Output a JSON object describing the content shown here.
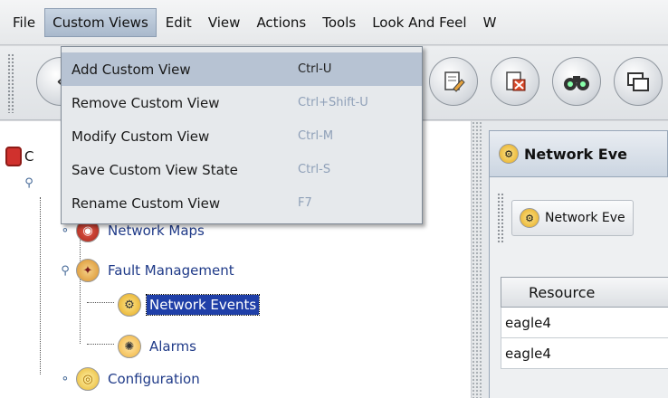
{
  "menubar": {
    "items": [
      {
        "label": "File"
      },
      {
        "label": "Custom Views"
      },
      {
        "label": "Edit"
      },
      {
        "label": "View"
      },
      {
        "label": "Actions"
      },
      {
        "label": "Tools"
      },
      {
        "label": "Look And Feel"
      },
      {
        "label": "W"
      }
    ]
  },
  "dropdown": {
    "items": [
      {
        "label": "Add Custom View",
        "accel": "Ctrl-U"
      },
      {
        "label": "Remove Custom View",
        "accel": "Ctrl+Shift-U"
      },
      {
        "label": "Modify Custom View",
        "accel": "Ctrl-M"
      },
      {
        "label": "Save Custom View State",
        "accel": "Ctrl-S"
      },
      {
        "label": "Rename Custom View",
        "accel": "F7"
      }
    ]
  },
  "tree": {
    "root_label": "C",
    "nodes": [
      {
        "label": "Network Maps",
        "icon": "network-maps-icon"
      },
      {
        "label": "Fault Management",
        "icon": "fault-management-icon"
      },
      {
        "label": "Network Events",
        "icon": "network-events-icon"
      },
      {
        "label": "Alarms",
        "icon": "alarms-icon"
      },
      {
        "label": "Configuration",
        "icon": "configuration-icon"
      }
    ]
  },
  "right_panel": {
    "title": "Network Eve",
    "sub_button": "Network Eve",
    "table": {
      "header": "Resource",
      "rows": [
        "eagle4",
        "eagle4"
      ]
    }
  },
  "colors": {
    "selection": "#1f3fa8",
    "menu_highlight": "#b7c3d3",
    "disabled_accel": "#8fa0b8"
  }
}
